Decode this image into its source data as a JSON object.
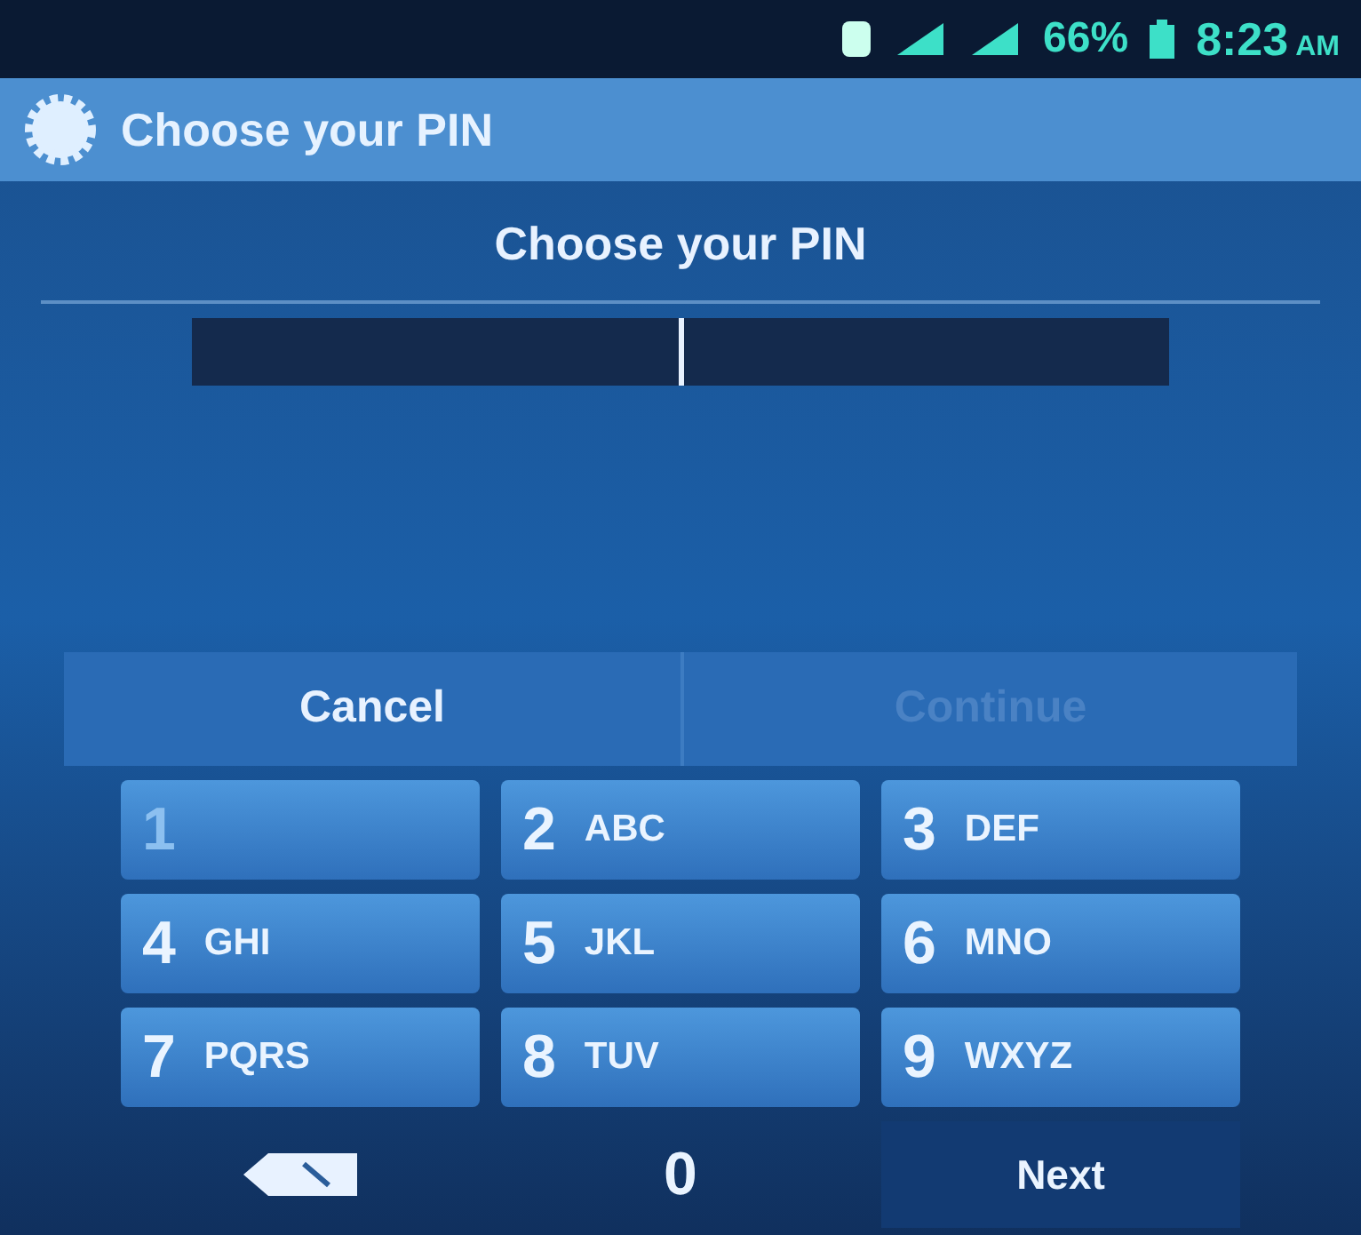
{
  "status_bar": {
    "battery": "66%",
    "time": "8:23",
    "meridiem": "AM"
  },
  "action_bar": {
    "title": "Choose your PIN"
  },
  "prompt": "Choose your PIN",
  "pin_field": {
    "focused": true
  },
  "buttons": [
    {
      "label": "Cancel",
      "disabled": false
    },
    {
      "label": "Continue",
      "disabled": true
    }
  ],
  "keys": [
    {
      "kind": "digit",
      "digit": "1"
    },
    {
      "kind": "digit",
      "digit": "2",
      "letters": "ABC"
    },
    {
      "kind": "digit",
      "digit": "3",
      "letters": "DEF"
    },
    {
      "kind": "digit",
      "digit": "4",
      "letters": "GHI"
    },
    {
      "kind": "digit",
      "digit": "5",
      "letters": "JKL"
    },
    {
      "kind": "digit",
      "digit": "6",
      "letters": "MNO"
    },
    {
      "kind": "digit",
      "digit": "7",
      "letters": "PQRS"
    },
    {
      "kind": "digit",
      "digit": "8",
      "letters": "TUV"
    },
    {
      "kind": "digit",
      "digit": "9",
      "letters": "WXYZ"
    },
    {
      "kind": "delete"
    },
    {
      "kind": "bottom",
      "digit": "0"
    },
    {
      "kind": "action",
      "label": "Next"
    }
  ]
}
